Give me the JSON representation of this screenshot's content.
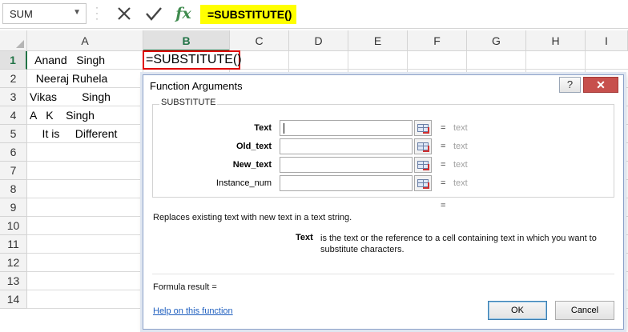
{
  "formula_bar": {
    "name_box": "SUM",
    "cancel_icon": "✕",
    "enter_icon": "✓",
    "fx_label": "fx",
    "formula": "=SUBSTITUTE()"
  },
  "sheet": {
    "columns": [
      "A",
      "B",
      "C",
      "D",
      "E",
      "F",
      "G",
      "H",
      "I"
    ],
    "rows": [
      "1",
      "2",
      "3",
      "4",
      "5",
      "6",
      "7",
      "8",
      "9",
      "10",
      "11",
      "12",
      "13",
      "14"
    ],
    "active_column": "B",
    "active_row": "1",
    "cells": {
      "A1": " Anand   Singh",
      "A2": "  Neeraj Ruhela",
      "A3": "Vikas        Singh",
      "A4": "A   K    Singh",
      "A5": "    It is     Different",
      "B1": "=SUBSTITUTE()"
    }
  },
  "dialog": {
    "title": "Function Arguments",
    "help_icon": "?",
    "close_icon": "✕",
    "function_name": "SUBSTITUTE",
    "args": [
      {
        "label": "Text",
        "value": "",
        "eq": "=",
        "result": "text"
      },
      {
        "label": "Old_text",
        "value": "",
        "eq": "=",
        "result": "text"
      },
      {
        "label": "New_text",
        "value": "",
        "eq": "=",
        "result": "text"
      },
      {
        "label": "Instance_num",
        "value": "",
        "eq": "=",
        "result": "text"
      }
    ],
    "result_eq": "=",
    "description": "Replaces existing text with new text in a text string.",
    "arg_help_name": "Text",
    "arg_help_text": "is the text or the reference to a cell containing text in which you want to substitute characters.",
    "formula_result": "Formula result =",
    "help_link": "Help on this function",
    "ok_label": "OK",
    "cancel_label": "Cancel"
  }
}
